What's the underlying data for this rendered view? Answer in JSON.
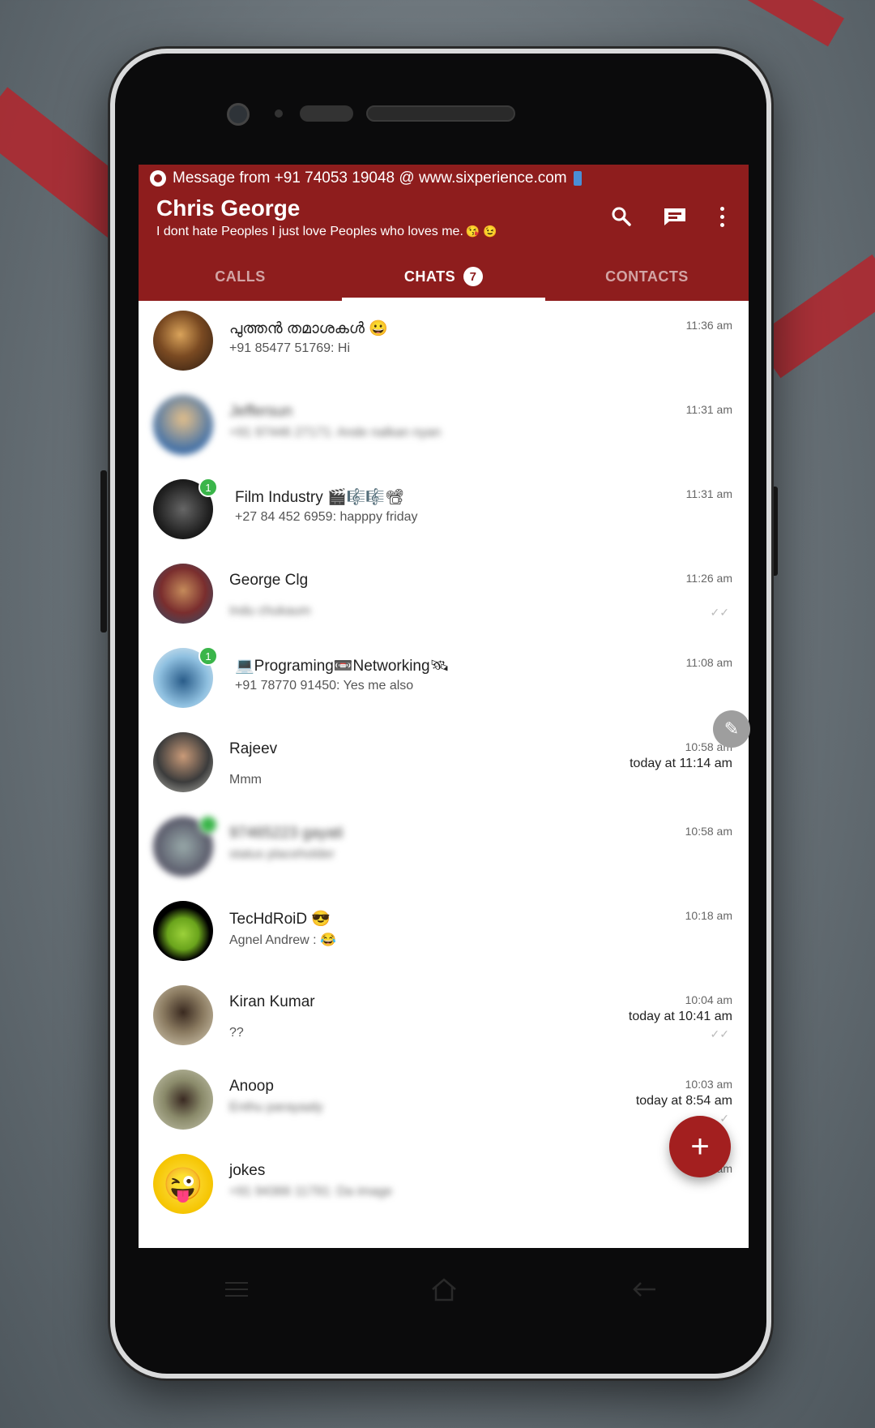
{
  "colors": {
    "appbar": "#8e1d1d",
    "unread": "#3ab54a",
    "fab": "#a31f1f"
  },
  "status": {
    "text": "Message from +91 74053 19048 @ www.sixperience.com"
  },
  "header": {
    "title": "Chris George",
    "subtitle": "I dont hate Peoples I just love Peoples who loves me.",
    "subtitle_emoji": "😘 😉",
    "icons": [
      "search-icon",
      "compose-icon",
      "more-vert-icon"
    ]
  },
  "tabs": [
    {
      "label": "CALLS"
    },
    {
      "label": "CHATS",
      "badge": "7"
    },
    {
      "label": "CONTACTS"
    }
  ],
  "chats": [
    {
      "name": "പുത്തൻ തമാശകൾ 😀",
      "preview": "+91 85477 51769: Hi",
      "time": "11:36 am"
    },
    {
      "name": "Jeffersun",
      "preview": "+91 97446 27171: Ande nalkan nyan",
      "time": "11:31 am",
      "blurred": true
    },
    {
      "name": "Film Industry 🎬🎼🎼📽",
      "preview": "+27 84 452 6959: happpy friday",
      "time": "11:31 am",
      "unread": "1"
    },
    {
      "name": "George Clg",
      "preview": "Indu chukaum",
      "time": "11:26 am",
      "preview_blurred": true
    },
    {
      "name": "💻Programing📼Networking🛰",
      "preview": "+91 78770 91450: Yes me also",
      "time": "11:08 am",
      "unread": "1"
    },
    {
      "name": "Rajeev",
      "preview": "Mmm",
      "time": "10:58 am",
      "last_seen": "today at 11:14 am"
    },
    {
      "name": "97465223 gayati",
      "preview": "status placeholder",
      "time": "10:58 am",
      "blurred": true
    },
    {
      "name": "TecHdRoiD 😎",
      "preview": "Agnel Andrew : 😂",
      "time": "10:18 am"
    },
    {
      "name": "Kiran Kumar",
      "preview": "??",
      "time": "10:04 am",
      "last_seen": "today at 10:41 am"
    },
    {
      "name": "Anoop",
      "preview": "Enthu parayaaly",
      "time": "10:03 am",
      "last_seen": "today at 8:54 am",
      "preview_blurred": true
    },
    {
      "name": "jokes",
      "preview": "+91 94366 11791: Da image",
      "time": "10:01 am",
      "preview_blurred": true
    }
  ],
  "fab": {
    "label": "+"
  },
  "edit": {
    "label": "✎"
  }
}
